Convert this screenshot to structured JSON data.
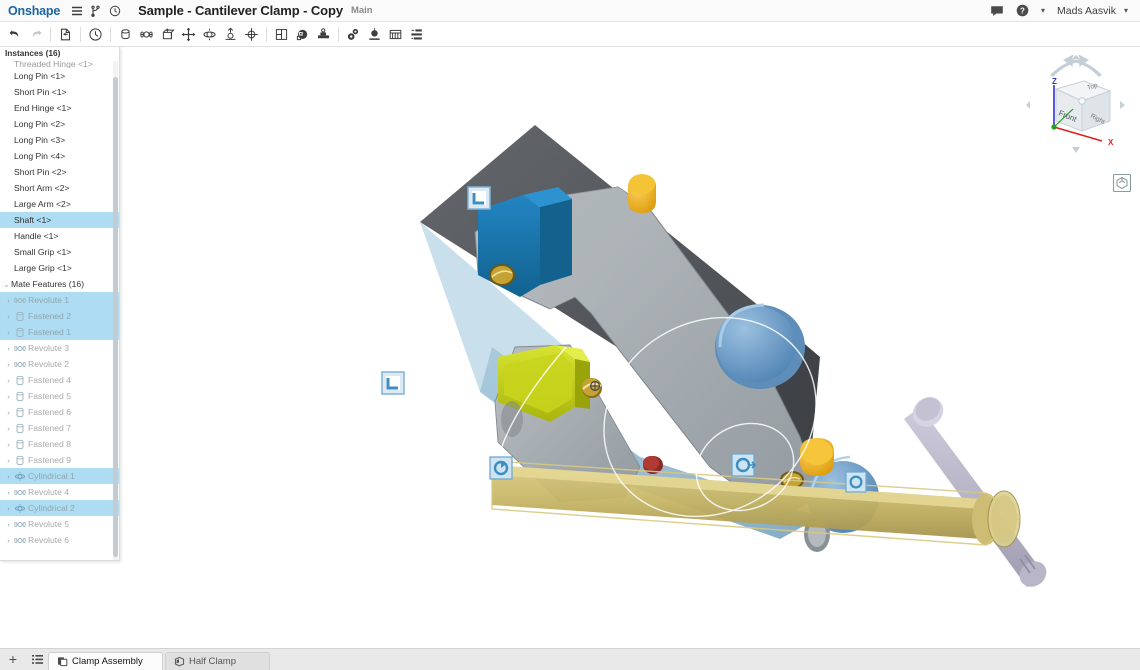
{
  "header": {
    "logo": "Onshape",
    "menu_icon": "hamburger-menu-icon",
    "branch_icon": "branch-icon",
    "history_icon": "history-clock-icon",
    "doc_title": "Sample - Cantilever Clamp - Copy",
    "branch_label": "Main",
    "comment_icon": "comment-icon",
    "help_icon": "help-icon",
    "user_name": "Mads Aasvik",
    "user_caret": "▾",
    "help_caret": "▾"
  },
  "toolbar": {
    "groups": [
      [
        {
          "name": "undo-button",
          "icon": "undo-arrow",
          "disabled": false
        },
        {
          "name": "redo-button",
          "icon": "redo-arrow",
          "disabled": true
        }
      ],
      [
        {
          "name": "insert-part-button",
          "icon": "insert-part",
          "disabled": false
        }
      ],
      [
        {
          "name": "assembly-history-button",
          "icon": "clock",
          "disabled": false
        }
      ],
      [
        {
          "name": "fastened-mate-button",
          "icon": "fastened-mate",
          "disabled": false
        },
        {
          "name": "revolute-mate-button",
          "icon": "revolute-mate",
          "disabled": false
        },
        {
          "name": "slider-mate-button",
          "icon": "slider-mate",
          "disabled": false
        },
        {
          "name": "planar-mate-button",
          "icon": "planar-mate",
          "disabled": false
        },
        {
          "name": "cylindrical-mate-button",
          "icon": "cylindrical-mate",
          "disabled": false
        },
        {
          "name": "pin-slot-mate-button",
          "icon": "pin-slot-mate",
          "disabled": false
        },
        {
          "name": "ball-mate-button",
          "icon": "ball-mate",
          "disabled": false
        }
      ],
      [
        {
          "name": "group-button",
          "icon": "group",
          "disabled": false
        },
        {
          "name": "replicate-button",
          "icon": "replicate",
          "disabled": false
        },
        {
          "name": "mate-connector-button",
          "icon": "mate-connector",
          "disabled": false
        }
      ],
      [
        {
          "name": "assembly-features-button",
          "icon": "gears",
          "disabled": false
        },
        {
          "name": "exploded-view-button",
          "icon": "explode",
          "disabled": false
        },
        {
          "name": "bom-button",
          "icon": "bill-of-materials",
          "disabled": false
        },
        {
          "name": "display-state-button",
          "icon": "display-state",
          "disabled": false
        }
      ]
    ]
  },
  "panel": {
    "instances_header": "Instances (16)",
    "clipped_item": "Threaded Hinge <1>",
    "instances": [
      {
        "label": "Long Pin <1>",
        "selected": false
      },
      {
        "label": "Short Pin <1>",
        "selected": false
      },
      {
        "label": "End Hinge <1>",
        "selected": false
      },
      {
        "label": "Long Pin <2>",
        "selected": false
      },
      {
        "label": "Long Pin <3>",
        "selected": false
      },
      {
        "label": "Long Pin <4>",
        "selected": false
      },
      {
        "label": "Short Pin <2>",
        "selected": false
      },
      {
        "label": "Short Arm <2>",
        "selected": false
      },
      {
        "label": "Large Arm <2>",
        "selected": false
      },
      {
        "label": "Shaft <1>",
        "selected": true
      },
      {
        "label": "Handle <1>",
        "selected": false
      },
      {
        "label": "Small Grip <1>",
        "selected": false
      },
      {
        "label": "Large Grip <1>",
        "selected": false
      }
    ],
    "mate_features_header": "Mate Features (16)",
    "mate_features": [
      {
        "label": "Revolute 1",
        "type": "revolute",
        "selected": true
      },
      {
        "label": "Fastened 2",
        "type": "fastened",
        "selected": true
      },
      {
        "label": "Fastened 1",
        "type": "fastened",
        "selected": true
      },
      {
        "label": "Revolute 3",
        "type": "revolute",
        "selected": false
      },
      {
        "label": "Revolute 2",
        "type": "revolute",
        "selected": false
      },
      {
        "label": "Fastened 4",
        "type": "fastened",
        "selected": false
      },
      {
        "label": "Fastened 5",
        "type": "fastened",
        "selected": false
      },
      {
        "label": "Fastened 6",
        "type": "fastened",
        "selected": false
      },
      {
        "label": "Fastened 7",
        "type": "fastened",
        "selected": false
      },
      {
        "label": "Fastened 8",
        "type": "fastened",
        "selected": false
      },
      {
        "label": "Fastened 9",
        "type": "fastened",
        "selected": false
      },
      {
        "label": "Cylindrical 1",
        "type": "cylindrical",
        "selected": true
      },
      {
        "label": "Revolute 4",
        "type": "revolute",
        "selected": false
      },
      {
        "label": "Cylindrical 2",
        "type": "cylindrical",
        "selected": true
      },
      {
        "label": "Revolute 5",
        "type": "revolute",
        "selected": false
      },
      {
        "label": "Revolute 6",
        "type": "revolute",
        "selected": false
      }
    ],
    "twisty_collapsed": "›",
    "twisty_expanded": "⌄",
    "selection_color": "#aedcf2"
  },
  "viewcube": {
    "face_front": "Front",
    "face_top": "Top",
    "face_right": "Right",
    "axis_x": "X",
    "axis_z": "Z",
    "axis_x_color": "#e02020",
    "axis_z_color": "#3030d0",
    "axis_y_color": "#20a020",
    "home_icon": "view-home-icon"
  },
  "model": {
    "colors": {
      "arm_gray": "#9ea4a8",
      "arm_gray_dark": "#55585c",
      "arm_light": "#b6bcc0",
      "grip_blue": "#1a73ad",
      "grip_yellow": "#c5d118",
      "pin_gold": "#c9a227",
      "pin_yellow": "#f0b41d",
      "body_blue": "#6f9fc9",
      "shaft_selected": "#c9b86a",
      "handle_lilac": "#b5b2c4",
      "plate_blue": "#9dc4db"
    },
    "mate_connector_icons": [
      "fastened-mate-marker",
      "fastened-mate-marker",
      "revolute-mate-marker",
      "revolute-mate-marker",
      "revolute-mate-marker",
      "revolute-mate-marker"
    ]
  },
  "tabbar": {
    "add_label": "+",
    "add_icon": "add-tab-icon",
    "list_icon": "tab-list-icon",
    "tabs": [
      {
        "label": "Clamp Assembly",
        "icon": "assembly-icon",
        "active": true
      },
      {
        "label": "Half Clamp",
        "icon": "part-studio-icon",
        "active": false
      }
    ]
  }
}
